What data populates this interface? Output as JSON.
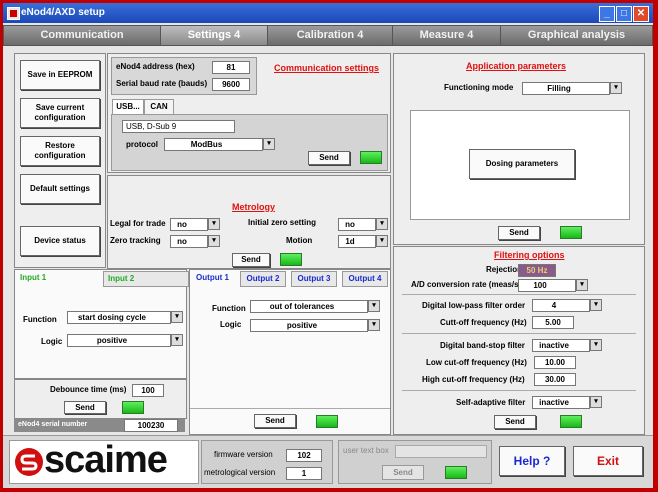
{
  "window": {
    "title": "eNod4/AXD setup",
    "min": "_",
    "max": "□",
    "close": "✕"
  },
  "tabs": [
    "Communication",
    "Settings 4",
    "Calibration 4",
    "Measure 4",
    "Graphical analysis"
  ],
  "left_buttons": {
    "save_eeprom": "Save in EEPROM",
    "save_current": "Save current configuration",
    "restore": "Restore configuration",
    "default": "Default settings",
    "device_status": "Device status"
  },
  "comm": {
    "address_label": "eNod4 address (hex)",
    "address_value": "81",
    "baud_label": "Serial baud rate (bauds)",
    "baud_value": "9600",
    "title": "Communication settings",
    "tab_usb": "USB...",
    "tab_can": "CAN",
    "usb_value": "USB, D-Sub 9",
    "protocol_label": "protocol",
    "protocol_value": "ModBus",
    "send": "Send"
  },
  "metrology": {
    "title": "Metrology",
    "legal_label": "Legal for trade",
    "legal_value": "no",
    "zero_setting_label": "Initial zero setting",
    "zero_setting_value": "no",
    "zero_tracking_label": "Zero tracking",
    "zero_tracking_value": "no",
    "motion_label": "Motion",
    "motion_value": "1d",
    "send": "Send"
  },
  "inputs": {
    "tab1": "Input 1",
    "tab2": "Input 2",
    "function_label": "Function",
    "function_value": "start dosing cycle",
    "logic_label": "Logic",
    "logic_value": "positive",
    "debounce_label": "Debounce time (ms)",
    "debounce_value": "100",
    "send": "Send"
  },
  "outputs": {
    "tabs": [
      "Output 1",
      "Output 2",
      "Output 3",
      "Output 4"
    ],
    "function_label": "Function",
    "function_value": "out of tolerances",
    "logic_label": "Logic",
    "logic_value": "positive",
    "send": "Send"
  },
  "serial": {
    "label": "eNod4 serial number",
    "value": "100230"
  },
  "app": {
    "title": "Application parameters",
    "mode_label": "Functioning mode",
    "mode_value": "Filling",
    "dosing_button": "Dosing parameters",
    "send": "Send"
  },
  "filtering": {
    "title": "Filtering options",
    "rejection_label": "Rejection",
    "rejection_value": "50 Hz",
    "ad_label": "A/D conversion rate (meas/s)",
    "ad_value": "100",
    "lowpass_order_label": "Digital low-pass filter order",
    "lowpass_order_value": "4",
    "cutoff_label": "Cutt-off frequency (Hz)",
    "cutoff_value": "5.00",
    "bandstop_label": "Digital band-stop filter",
    "bandstop_value": "inactive",
    "low_cut_label": "Low cut-off frequency (Hz)",
    "low_cut_value": "10.00",
    "high_cut_label": "High cut-off frequency (Hz)",
    "high_cut_value": "30.00",
    "self_adaptive_label": "Self-adaptive filter",
    "self_adaptive_value": "inactive",
    "send": "Send"
  },
  "footer": {
    "logo": "scaime",
    "firmware_label": "firmware version",
    "firmware_value": "102",
    "metro_label": "metrological version",
    "metro_value": "1",
    "user_text_label": "user text box",
    "send": "Send",
    "help": "Help ?",
    "exit": "Exit"
  },
  "icons": {
    "dropdown": "▾"
  },
  "colors": {
    "accent_red": "#e01010",
    "led_green": "#22cc22",
    "frame_red": "#c00000",
    "title_blue": "#1a48b8"
  }
}
